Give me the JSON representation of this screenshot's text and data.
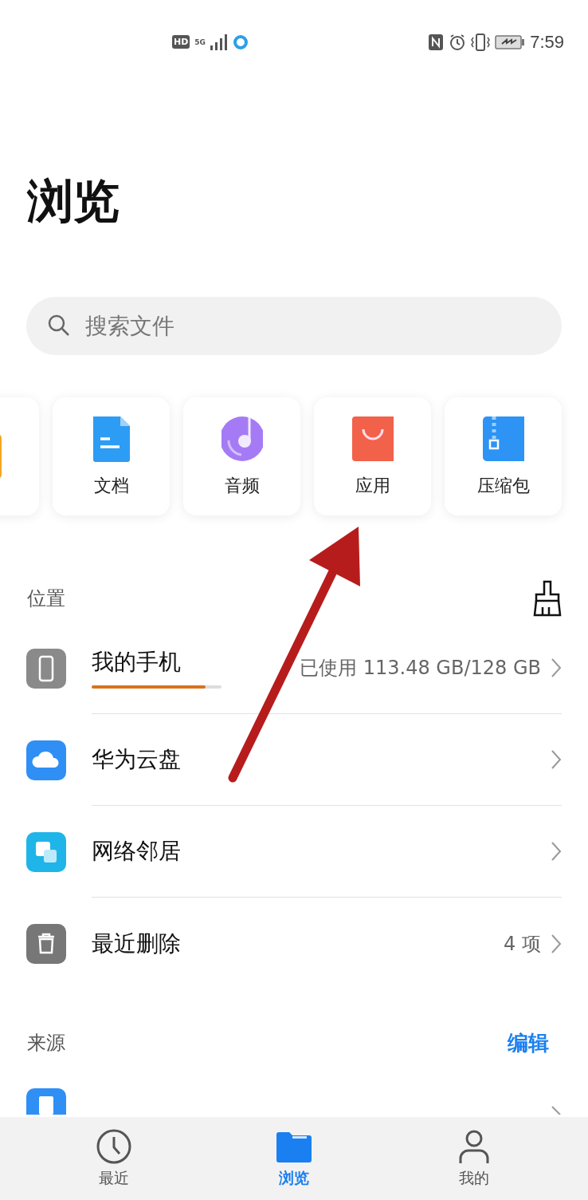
{
  "status_bar": {
    "hd": "HD",
    "network": "5G",
    "time": "7:59"
  },
  "title": "浏览",
  "search": {
    "placeholder": "搜索文件"
  },
  "categories": [
    {
      "kind": "image"
    },
    {
      "kind": "doc",
      "label": "文档"
    },
    {
      "kind": "audio",
      "label": "音频"
    },
    {
      "kind": "app",
      "label": "应用"
    },
    {
      "kind": "zip",
      "label": "压缩包"
    }
  ],
  "locations": {
    "header": "位置",
    "items": [
      {
        "kind": "phone",
        "label": "我的手机",
        "detail": "已使用 113.48 GB/128 GB",
        "level": 0.88
      },
      {
        "kind": "cloud",
        "label": "华为云盘"
      },
      {
        "kind": "network",
        "label": "网络邻居"
      },
      {
        "kind": "trash",
        "label": "最近删除",
        "detail": "4 项"
      }
    ]
  },
  "sources": {
    "header": "来源",
    "action": "编辑",
    "items": [
      {
        "kind": "download"
      }
    ]
  },
  "tabs": [
    {
      "kind": "recent",
      "label": "最近",
      "selected": false
    },
    {
      "kind": "browse",
      "label": "浏览",
      "selected": true
    },
    {
      "kind": "mine",
      "label": "我的",
      "selected": false
    }
  ]
}
